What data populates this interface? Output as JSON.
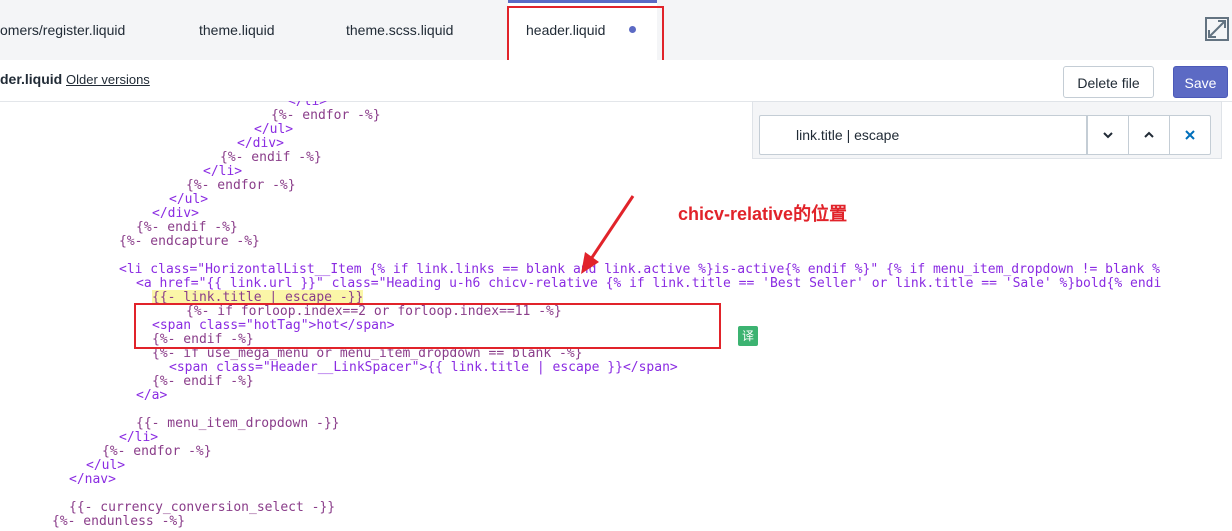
{
  "tabs": [
    {
      "label": "omers/register.liquid"
    },
    {
      "label": "theme.liquid"
    },
    {
      "label": "theme.scss.liquid"
    },
    {
      "label": "header.liquid"
    }
  ],
  "toolbar": {
    "filename": "der.liquid",
    "older_versions": "Older versions",
    "delete_label": "Delete file",
    "save_label": "Save"
  },
  "search": {
    "value": "link.title | escape"
  },
  "annotation": "chicv-relative的位置",
  "translate_badge": "译",
  "code": [
    "</li>",
    "{%- endfor -%}",
    "</ul>",
    "</div>",
    "{%- endif -%}",
    "</li>",
    "{%- endfor -%}",
    "</ul>",
    "</div>",
    "{%- endif -%}",
    "{%- endcapture -%}",
    "",
    "<li class=\"HorizontalList__Item {% if link.links == blank and link.active %}is-active{% endif %}\" {% if menu_item_dropdown != blank %",
    "<a href=\"{{ link.url }}\" class=\"Heading u-h6 chicv-relative {% if link.title == 'Best Seller' or link.title == 'Sale' %}bold{% endi",
    "{{- link.title | escape -}}",
    "{%- if forloop.index==2 or forloop.index==11 -%}",
    "<span class=\"hotTag\">hot</span>",
    "{%- endif -%}",
    "{%- if use_mega_menu or menu_item_dropdown == blank -%}",
    "<span class=\"Header__LinkSpacer\">{{ link.title | escape }}</span>",
    "{%- endif -%}",
    "</a>",
    "",
    "{{- menu_item_dropdown -}}",
    "</li>",
    "{%- endfor -%}",
    "</ul>",
    "</nav>",
    "",
    "{{- currency_conversion_select -}}",
    "{%- endunless -%}"
  ]
}
